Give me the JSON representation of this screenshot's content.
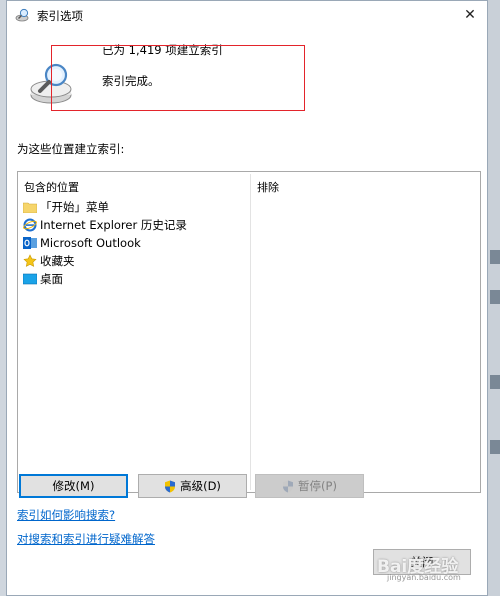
{
  "window": {
    "title": "索引选项",
    "close_glyph": "✕"
  },
  "status": {
    "count_text": "已为 1,419 项建立索引",
    "message": "索引完成。"
  },
  "locations": {
    "section_label": "为这些位置建立索引:",
    "columns": {
      "included": "包含的位置",
      "excluded": "排除"
    },
    "items": [
      {
        "label": "「开始」菜单",
        "icon": "folder-icon"
      },
      {
        "label": "Internet Explorer 历史记录",
        "icon": "internet-explorer-icon"
      },
      {
        "label": "Microsoft Outlook",
        "icon": "outlook-icon"
      },
      {
        "label": "收藏夹",
        "icon": "star-icon"
      },
      {
        "label": "桌面",
        "icon": "desktop-icon"
      }
    ]
  },
  "buttons": {
    "modify": "修改(M)",
    "advanced": "高级(D)",
    "pause": "暂停(P)",
    "close": "关闭"
  },
  "links": {
    "affect_search": "索引如何影响搜索?",
    "troubleshoot": "对搜索和索引进行疑难解答"
  },
  "watermark": {
    "brand": "Bai度经验",
    "url": "jingyan.baidu.com"
  },
  "colors": {
    "highlight_frame": "#e3242b",
    "link": "#0066cc",
    "default_button_border": "#0078d7"
  }
}
